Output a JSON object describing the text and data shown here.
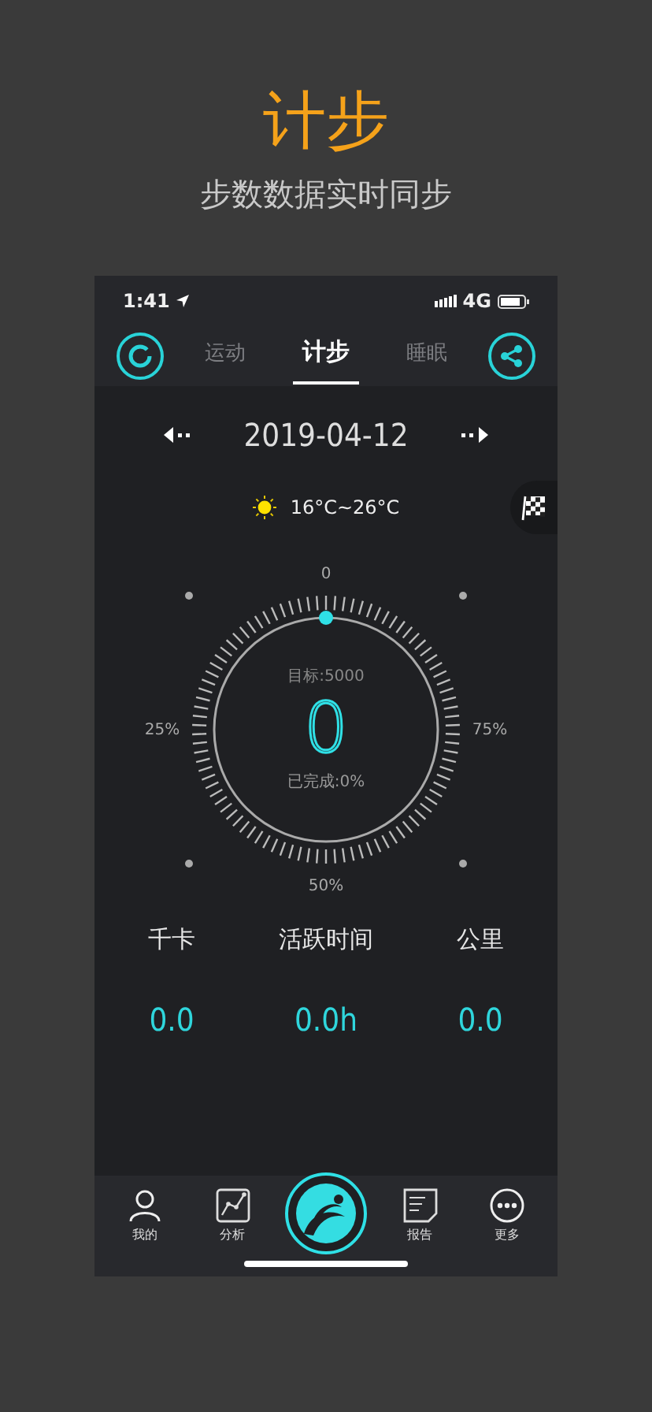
{
  "promo": {
    "title": "计步",
    "subtitle": "步数数据实时同步"
  },
  "status_bar": {
    "time": "1:41",
    "network": "4G"
  },
  "tabs": [
    {
      "label": "运动",
      "selected": false
    },
    {
      "label": "计步",
      "selected": true
    },
    {
      "label": "睡眠",
      "selected": false
    }
  ],
  "date": "2019-04-12",
  "weather": {
    "temperature": "16°C~26°C"
  },
  "dial": {
    "top_label": "0",
    "left_label": "25%",
    "right_label": "75%",
    "bottom_label": "50%",
    "goal": "目标:5000",
    "steps": "0",
    "completed": "已完成:0%"
  },
  "stats": [
    {
      "label": "千卡",
      "value": "0.0"
    },
    {
      "label": "活跃时间",
      "value": "0.0h"
    },
    {
      "label": "公里",
      "value": "0.0"
    }
  ],
  "bottom_nav": [
    {
      "kind": "person",
      "label": "我的"
    },
    {
      "kind": "chart",
      "label": "分析"
    },
    {
      "kind": "center"
    },
    {
      "kind": "report",
      "label": "报告"
    },
    {
      "kind": "more",
      "label": "更多"
    }
  ]
}
